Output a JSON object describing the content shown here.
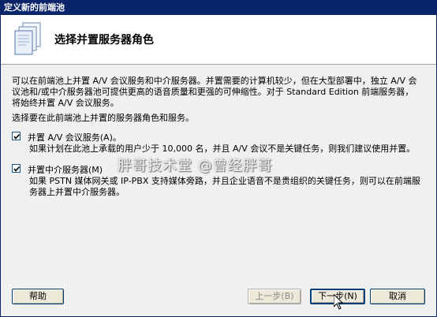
{
  "window": {
    "title": "定义新的前端池"
  },
  "header": {
    "title": "选择并置服务器角色",
    "icon": "server-pages-icon"
  },
  "intro": {
    "line1": "可以在前端池上并置 A/V 会议服务和中介服务器。并置需要的计算机较少，但在大型部署中，独立 A/V 会",
    "line2": "议池和/或中介服务器池可提供更高的语音质量和更强的可伸缩性。对于 Standard Edition 前端服务器，",
    "line3": "将始终并置 A/V 会议服务。"
  },
  "prompt": "选择要在此前端池上并置的服务器角色和服务。",
  "options": [
    {
      "label": "并置 A/V 会议服务(A)。",
      "checked": true,
      "desc_line1": "如果计划在此池上承载的用户少于 10,000 名，并且 A/V 会议不是关键任务，则我们建议使用并置。"
    },
    {
      "label": "并置中介服务器(M)",
      "checked": true,
      "desc_line1": "如果 PSTN 媒体网关或 IP-PBX 支持媒体旁路，并且企业语音不是贵组织的关键任务，则可以在前端服",
      "desc_line2": "务器上并置中介服务器。"
    }
  ],
  "watermark": "胖哥技术堂 @曾经胖哥",
  "buttons": {
    "help": "帮助",
    "back": "上一步(B)",
    "next": "下一步(N)",
    "cancel": "取消"
  }
}
